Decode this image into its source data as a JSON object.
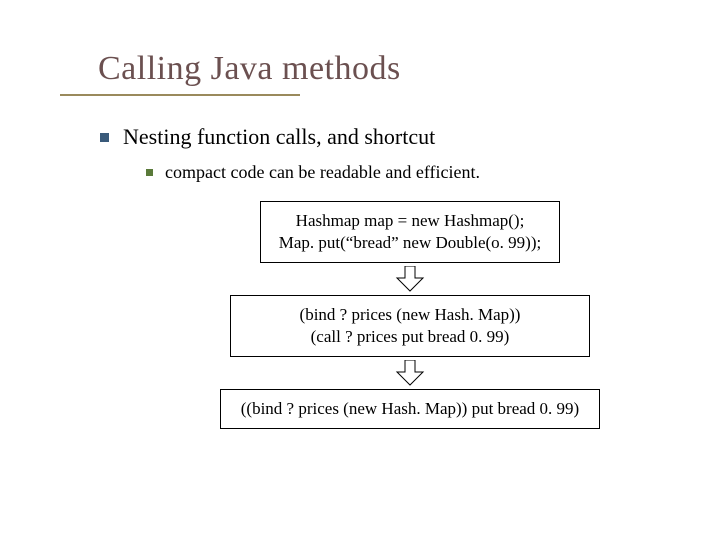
{
  "title": "Calling Java methods",
  "bullets": {
    "l1": "Nesting function calls, and shortcut",
    "l2": "compact code can be readable and efficient."
  },
  "boxes": {
    "b1_line1": "Hashmap map = new Hashmap();",
    "b1_line2": "Map. put(“bread” new Double(o. 99));",
    "b2_line1": "(bind ? prices (new Hash. Map))",
    "b2_line2": "(call ? prices put bread 0. 99)",
    "b3_line1": "((bind ? prices (new Hash. Map)) put bread 0. 99)"
  }
}
